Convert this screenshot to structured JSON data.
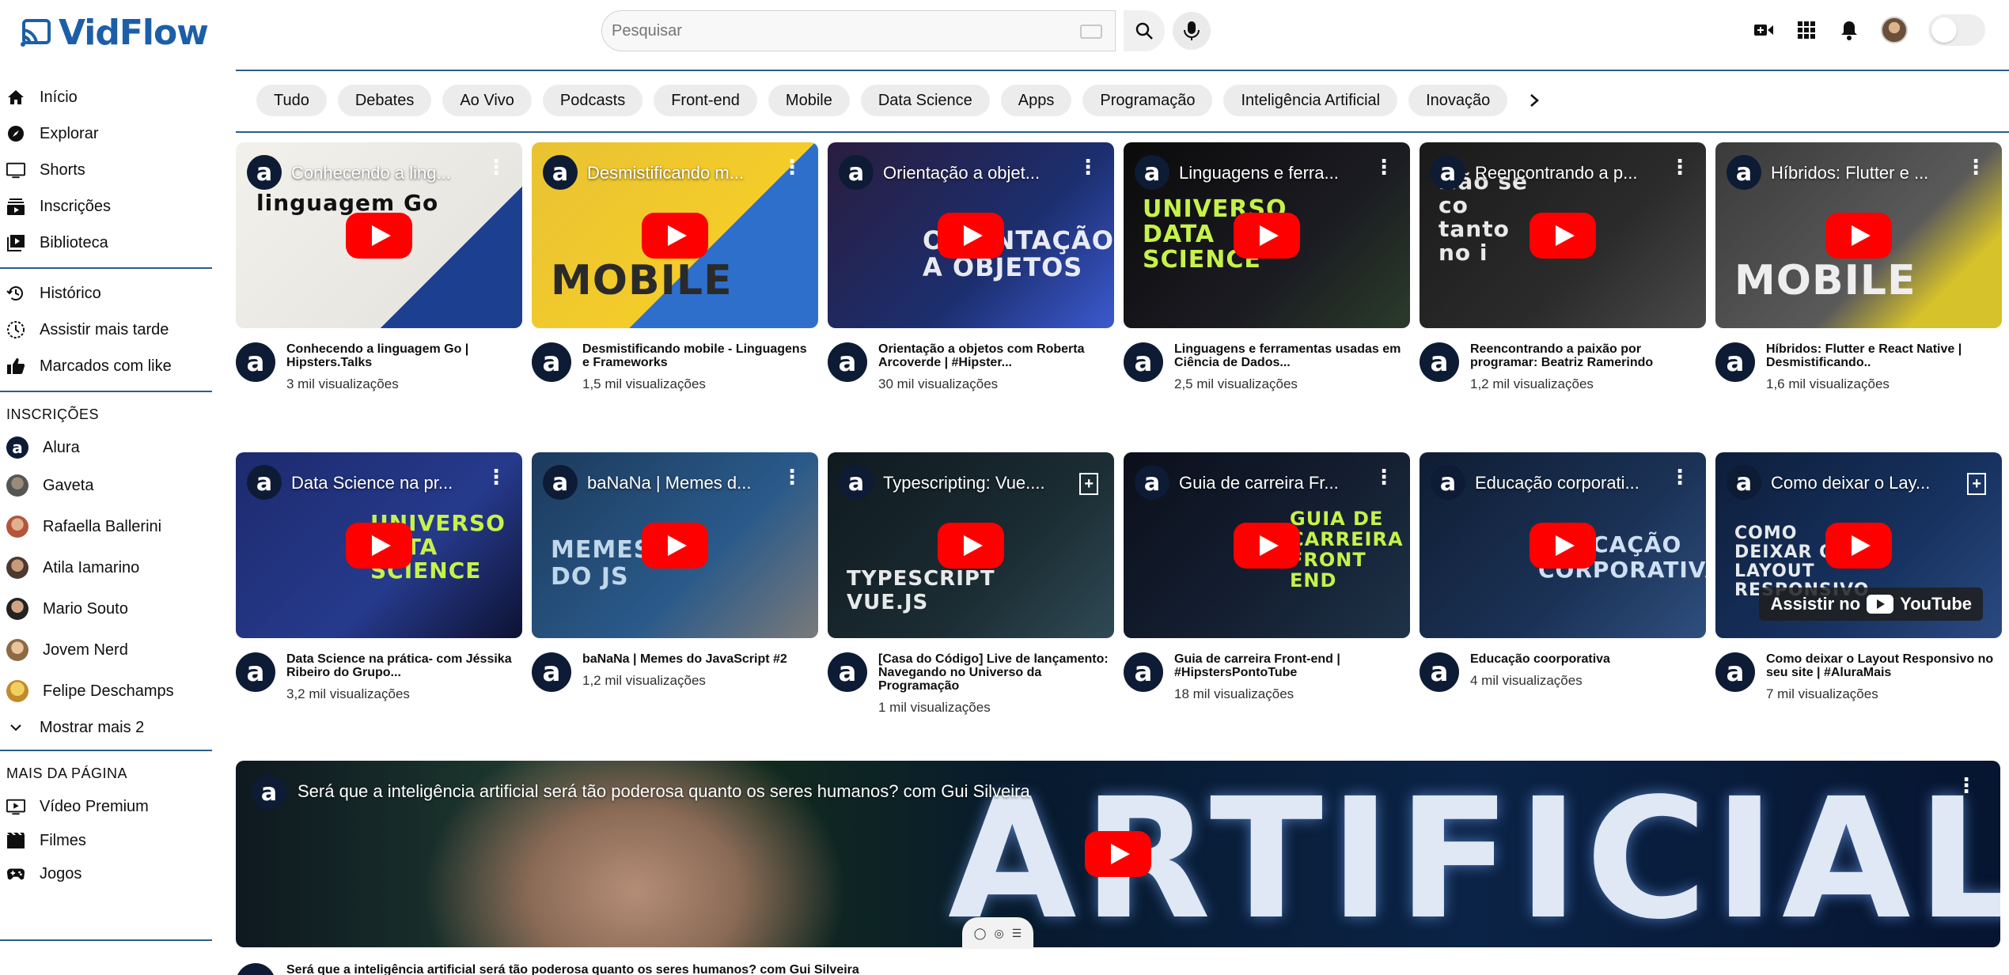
{
  "brand": {
    "name": "VidFlow",
    "color": "#1c5fa8"
  },
  "search": {
    "placeholder": "Pesquisar"
  },
  "sidebar": {
    "main": [
      {
        "label": "Início",
        "icon": "home-icon"
      },
      {
        "label": "Explorar",
        "icon": "compass-icon"
      },
      {
        "label": "Shorts",
        "icon": "shorts-icon"
      },
      {
        "label": "Inscrições",
        "icon": "subscriptions-icon"
      },
      {
        "label": "Biblioteca",
        "icon": "library-icon"
      }
    ],
    "library": [
      {
        "label": "Histórico",
        "icon": "history-icon"
      },
      {
        "label": "Assistir mais tarde",
        "icon": "clock-icon"
      },
      {
        "label": "Marcados com like",
        "icon": "thumbs-up-icon"
      }
    ],
    "subs_header": "INSCRIÇÕES",
    "subs": [
      {
        "label": "Alura"
      },
      {
        "label": "Gaveta"
      },
      {
        "label": "Rafaella Ballerini"
      },
      {
        "label": "Atila Iamarino"
      },
      {
        "label": "Mario Souto"
      },
      {
        "label": "Jovem Nerd"
      },
      {
        "label": "Felipe Deschamps"
      }
    ],
    "show_more": "Mostrar mais 2",
    "more_header": "MAIS DA PÁGINA",
    "more": [
      {
        "label": "Vídeo Premium",
        "icon": "premium-icon"
      },
      {
        "label": "Filmes",
        "icon": "film-icon"
      },
      {
        "label": "Jogos",
        "icon": "gamepad-icon"
      }
    ]
  },
  "chips": [
    "Tudo",
    "Debates",
    "Ao Vivo",
    "Podcasts",
    "Front-end",
    "Mobile",
    "Data Science",
    "Apps",
    "Programação",
    "Inteligência Artificial",
    "Inovação"
  ],
  "videos_row1": [
    {
      "thumb_title": "Conhecendo a ling...",
      "title": "Conhecendo a linguagem Go | Hipsters.Talks",
      "views": "3 mil visualizações"
    },
    {
      "thumb_title": "Desmistificando m...",
      "title": "Desmistificando mobile - Linguagens e Frameworks",
      "views": "1,5 mil visualizações"
    },
    {
      "thumb_title": "Orientação a objet...",
      "title": "Orientação a objetos com Roberta Arcoverde | #Hipster...",
      "views": "30 mil visualizações"
    },
    {
      "thumb_title": "Linguagens e ferra...",
      "title": "Linguagens e ferramentas usadas em Ciência de Dados...",
      "views": "2,5 mil visualizações"
    },
    {
      "thumb_title": "Reencontrando a p...",
      "title": "Reencontrando a paixão por programar: Beatriz Ramerindo",
      "views": "1,2 mil visualizações"
    },
    {
      "thumb_title": "Híbridos: Flutter e ...",
      "title": "Híbridos: Flutter e React Native | Desmistificando..",
      "views": "1,6 mil visualizações"
    }
  ],
  "videos_row2": [
    {
      "thumb_title": "Data Science na pr...",
      "title": "Data Science na prática- com Jéssika Ribeiro do Grupo...",
      "views": "3,2 mil visualizações"
    },
    {
      "thumb_title": "baNaNa | Memes d...",
      "title": "baNaNa | Memes do JavaScript #2",
      "views": "1,2 mil visualizações"
    },
    {
      "thumb_title": "Typescripting: Vue....",
      "title": "[Casa do Código] Live de lançamento: Navegando no Universo da Programação",
      "views": "1 mil visualizações"
    },
    {
      "thumb_title": "Guia de carreira Fr...",
      "title": "Guia de carreira Front-end | #HipstersPontoTube",
      "views": "18 mil visualizações"
    },
    {
      "thumb_title": "Educação corporati...",
      "title": "Educação coorporativa",
      "views": "4 mil visualizações"
    },
    {
      "thumb_title": "Como deixar o Lay...",
      "title": "Como deixar o Layout Responsivo no seu site | #AluraMais",
      "views": "7 mil visualizações"
    }
  ],
  "thumb_text": {
    "r1": [
      "linguagem Go",
      "MOBILE",
      "ORIENTAÇÃO A OBJETOS",
      "UNIVERSO DATA SCIENCE",
      "Não se co tanto no i",
      "MOBILE"
    ],
    "r2": [
      "UNIVERSO DATA SCIENCE",
      "MEMES DO JS",
      "TYPESCRIPT VUE.JS",
      "GUIA DE CARREIRA FRONT END",
      "EDUCAÇÃO CORPORATIVA",
      "COMO DEIXAR O LAYOUT RESPONSIVO"
    ]
  },
  "youtube_badge": {
    "prefix": "Assistir no",
    "brand": "YouTube"
  },
  "feature": {
    "thumb_title": "Será que a inteligência artificial será tão poderosa quanto os seres humanos? com Gui Silveira",
    "word": "ARTIFICIAL",
    "title": "Será que a inteligência artificial será tão poderosa quanto os seres humanos? com Gui Silveira"
  },
  "channel_glyph": "a"
}
